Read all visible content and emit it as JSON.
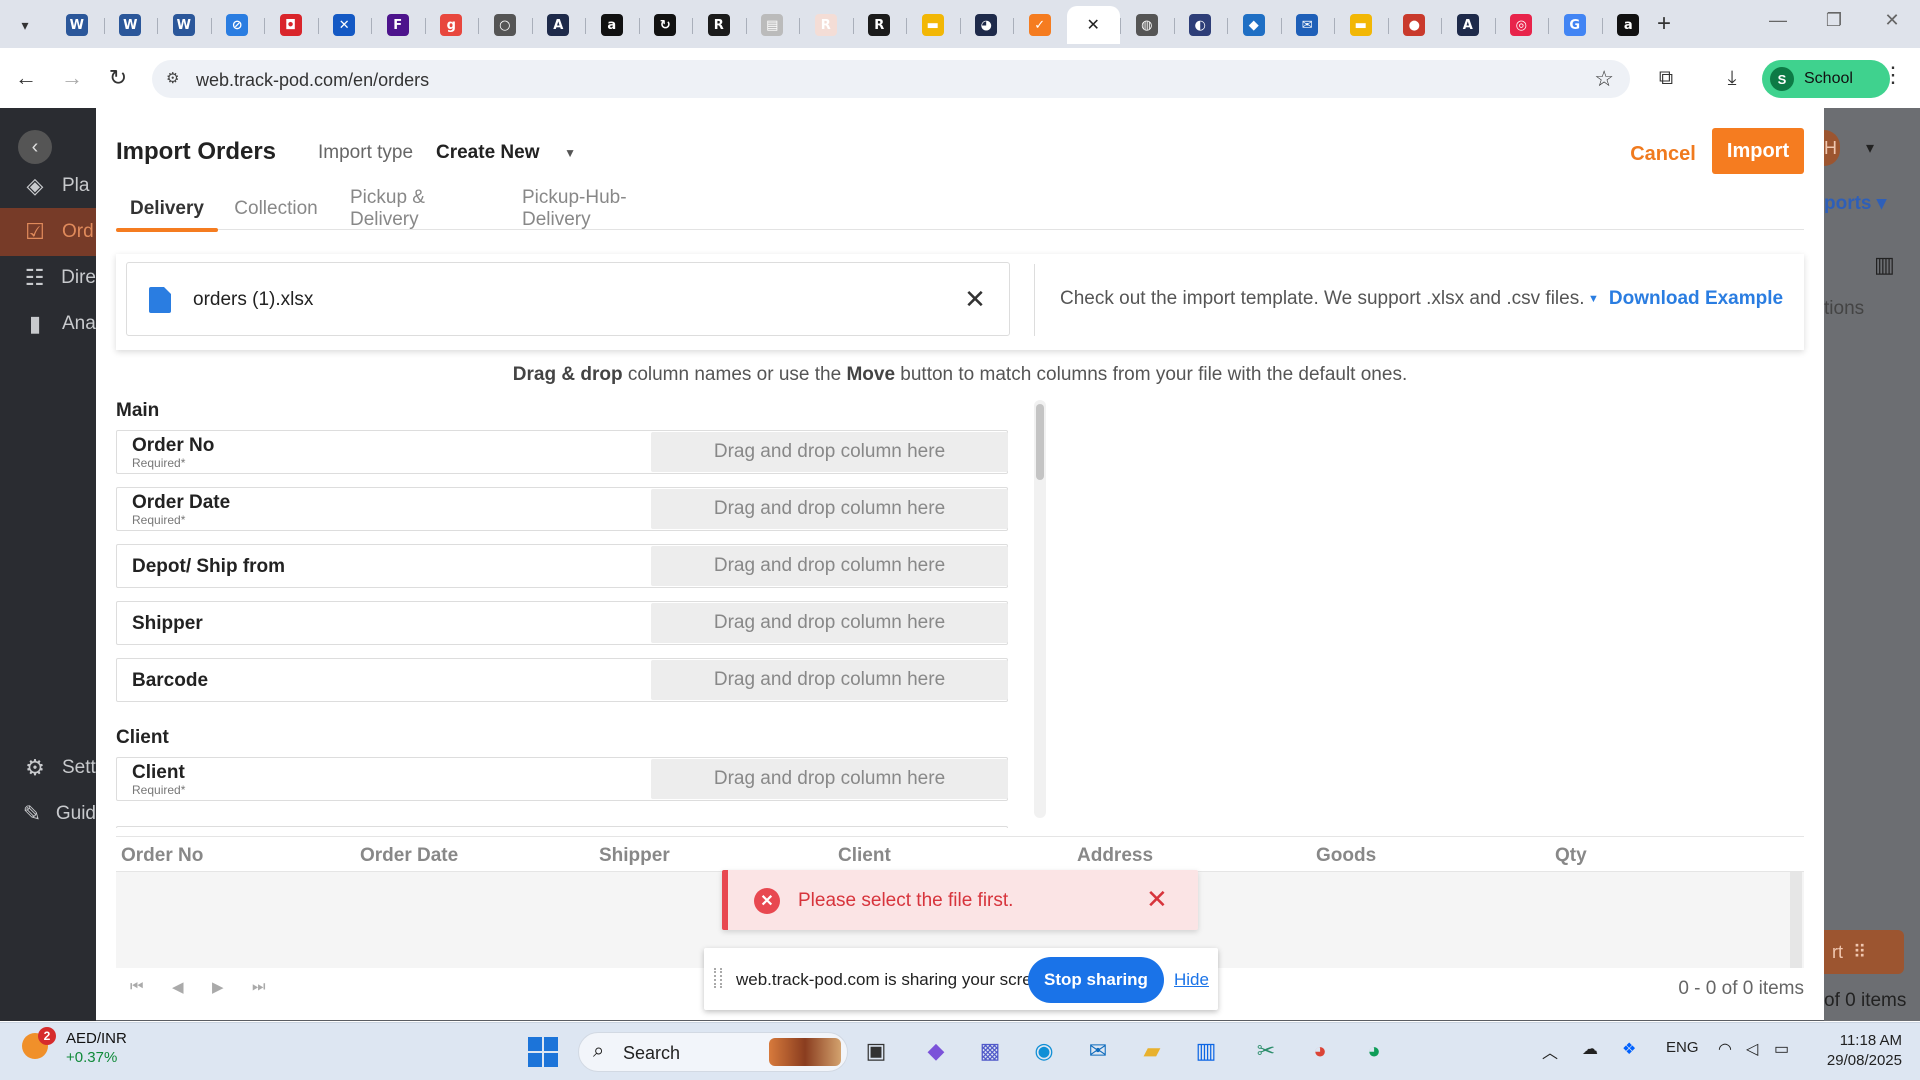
{
  "browser": {
    "url": "web.track-pod.com/en/orders",
    "profile_initial": "S",
    "profile_label": "School",
    "tabs": [
      {
        "icon": "word-icon",
        "glyph": "W",
        "color": "#2b579a"
      },
      {
        "icon": "word-icon",
        "glyph": "W",
        "color": "#2b579a"
      },
      {
        "icon": "word-icon",
        "glyph": "W",
        "color": "#2b579a"
      },
      {
        "icon": "compass-icon",
        "glyph": "⊘",
        "color": "#2a7de1"
      },
      {
        "icon": "app-red-icon",
        "glyph": "◘",
        "color": "#d9252b"
      },
      {
        "icon": "xing-icon",
        "glyph": "✕",
        "color": "#1459c4"
      },
      {
        "icon": "fedex-icon",
        "glyph": "F",
        "color": "#4d148c"
      },
      {
        "icon": "go-icon",
        "glyph": "g",
        "color": "#e8473e"
      },
      {
        "icon": "circle-icon",
        "glyph": "○",
        "color": "#555555"
      },
      {
        "icon": "a-icon",
        "glyph": "A",
        "color": "#1e2a4a"
      },
      {
        "icon": "amazon-icon",
        "glyph": "a",
        "color": "#111111"
      },
      {
        "icon": "refresh-circle-icon",
        "glyph": "↻",
        "color": "#111111"
      },
      {
        "icon": "r-icon",
        "glyph": "R",
        "color": "#1b1b1b"
      },
      {
        "icon": "image-icon",
        "glyph": "▤",
        "color": "#bbbbbb"
      },
      {
        "icon": "r-light-icon",
        "glyph": "R",
        "color": "#f4ddd6"
      },
      {
        "icon": "r-icon",
        "glyph": "R",
        "color": "#1b1b1b"
      },
      {
        "icon": "yellow-bar-icon",
        "glyph": "▬",
        "color": "#f2b705"
      },
      {
        "icon": "swirl-icon",
        "glyph": "◕",
        "color": "#1e2a4a"
      },
      {
        "icon": "check-icon",
        "glyph": "✓",
        "color": "#f57c20"
      },
      {
        "icon": "close-icon",
        "glyph": "✕",
        "color": "#ffffff",
        "active": true
      },
      {
        "icon": "globe-icon",
        "glyph": "◍",
        "color": "#555555"
      },
      {
        "icon": "planet-icon",
        "glyph": "◐",
        "color": "#2e3e78"
      },
      {
        "icon": "cube-icon",
        "glyph": "◆",
        "color": "#1f6fc4"
      },
      {
        "icon": "ticket-icon",
        "glyph": "✉",
        "color": "#1e5fb8"
      },
      {
        "icon": "yellow-bar-icon",
        "glyph": "▬",
        "color": "#f2b705"
      },
      {
        "icon": "red-dot-icon",
        "glyph": "●",
        "color": "#c93a2c"
      },
      {
        "icon": "a-icon",
        "glyph": "A",
        "color": "#1e2a4a"
      },
      {
        "icon": "target-icon",
        "glyph": "◎",
        "color": "#e8244b"
      },
      {
        "icon": "google-icon",
        "glyph": "G",
        "color": "#4285f4"
      },
      {
        "icon": "amazon-icon",
        "glyph": "a",
        "color": "#111111"
      }
    ]
  },
  "app_bg": {
    "nav": [
      {
        "icon": "plan-icon",
        "glyph": "◈",
        "label": "Pla"
      },
      {
        "icon": "orders-icon",
        "glyph": "☑",
        "label": "Ord",
        "active": true
      },
      {
        "icon": "directory-icon",
        "glyph": "☷",
        "label": "Dire"
      },
      {
        "icon": "analytics-icon",
        "glyph": "▮",
        "label": "Ana"
      },
      {
        "icon": "settings-icon",
        "glyph": "⚙",
        "label": "Sett"
      },
      {
        "icon": "guide-icon",
        "glyph": "✎",
        "label": "Guid"
      }
    ],
    "right_reports": "ports",
    "right_columns": "tions",
    "right_export": "rt",
    "right_items": "of 0 items",
    "right_badge": "H"
  },
  "modal": {
    "title": "Import Orders",
    "import_type_label": "Import type",
    "import_type_value": "Create New",
    "cancel_label": "Cancel",
    "import_label": "Import",
    "tabs": [
      "Delivery",
      "Collection",
      "Pickup & Delivery",
      "Pickup-Hub-Delivery"
    ],
    "file_name": "orders (1).xlsx",
    "template_note": "Check out the import template. We support .xlsx and .csv files.",
    "download_label": "Download Example",
    "hint_bold1": "Drag & drop",
    "hint_mid": " column names or use the ",
    "hint_bold2": "Move",
    "hint_end": " button to match columns from your file with the default ones.",
    "drop_placeholder": "Drag and drop column here",
    "required_text": "Required*",
    "sections": [
      {
        "title": "Main",
        "fields": [
          {
            "label": "Order No",
            "required": true
          },
          {
            "label": "Order Date",
            "required": true
          },
          {
            "label": "Depot/ Ship from",
            "required": false
          },
          {
            "label": "Shipper",
            "required": false
          },
          {
            "label": "Barcode",
            "required": false
          }
        ]
      },
      {
        "title": "Client",
        "fields": [
          {
            "label": "Client",
            "required": true
          }
        ]
      }
    ],
    "preview_columns": [
      "Order No",
      "Order Date",
      "Shipper",
      "Client",
      "Address",
      "Goods",
      "Qty"
    ],
    "pager_info": "0 - 0 of 0 items"
  },
  "toast": {
    "message": "Please select the file first."
  },
  "share_bar": {
    "text": "web.track-pod.com is sharing your screen.",
    "stop_label": "Stop sharing",
    "hide_label": "Hide"
  },
  "taskbar": {
    "ticker_badge": "2",
    "ticker_name": "AED/INR",
    "ticker_change": "+0.37%",
    "search_label": "Search",
    "lang": "ENG",
    "time": "11:18 AM",
    "date": "29/08/2025"
  }
}
